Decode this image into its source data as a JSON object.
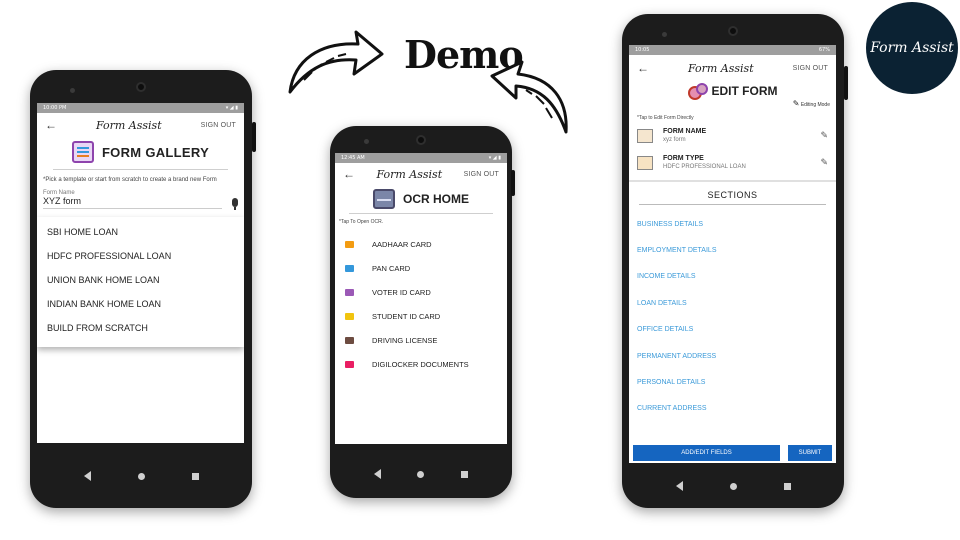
{
  "demo_title": "Demo",
  "logo_text": "Form Assist",
  "phone1": {
    "status_time": "10:00 PM",
    "brand": "Form Assist",
    "sign_out": "SIGN OUT",
    "title": "FORM GALLERY",
    "hint": "*Pick a template or start from scratch to create a brand new Form",
    "field_label": "Form Name",
    "field_value": "XYZ form",
    "options": [
      "SBI HOME LOAN",
      "HDFC PROFESSIONAL LOAN",
      "UNION BANK HOME LOAN",
      "INDIAN BANK HOME LOAN",
      "BUILD FROM SCRATCH"
    ]
  },
  "phone2": {
    "status_time": "12:45 AM",
    "brand": "Form Assist",
    "sign_out": "SIGN OUT",
    "title": "OCR HOME",
    "hint": "*Tap To Open OCR.",
    "items": [
      {
        "label": "AADHAAR CARD",
        "icon": "card-icon",
        "color": "#f39c12"
      },
      {
        "label": "PAN CARD",
        "icon": "id-icon",
        "color": "#3498db"
      },
      {
        "label": "VOTER ID CARD",
        "icon": "briefcase-icon",
        "color": "#9b59b6"
      },
      {
        "label": "STUDENT ID CARD",
        "icon": "user-icon",
        "color": "#f1c40f"
      },
      {
        "label": "DRIVING LICENSE",
        "icon": "license-icon",
        "color": "#6d4c41"
      },
      {
        "label": "DIGILOCKER DOCUMENTS",
        "icon": "phone-icon",
        "color": "#e91e63"
      }
    ]
  },
  "phone3": {
    "status_time": "10:05",
    "status_battery": "67%",
    "brand": "Form Assist",
    "sign_out": "SIGN OUT",
    "title": "EDIT FORM",
    "editing_mode": "Editing Mode",
    "hint": "*Tap to Edit Form Directly",
    "form_name_label": "FORM NAME",
    "form_name_value": "xyz form",
    "form_type_label": "FORM TYPE",
    "form_type_value": "HDFC PROFESSIONAL LOAN",
    "sections_label": "SECTIONS",
    "sections": [
      "BUSINESS DETAILS",
      "EMPLOYMENT DETAILS",
      "INCOME DETAILS",
      "LOAN DETAILS",
      "OFFICE DETAILS",
      "PERMANENT ADDRESS",
      "PERSONAL DETAILS",
      "CURRENT ADDRESS"
    ],
    "add_edit_button": "ADD/EDIT FIELDS",
    "submit_button": "SUBMIT"
  }
}
